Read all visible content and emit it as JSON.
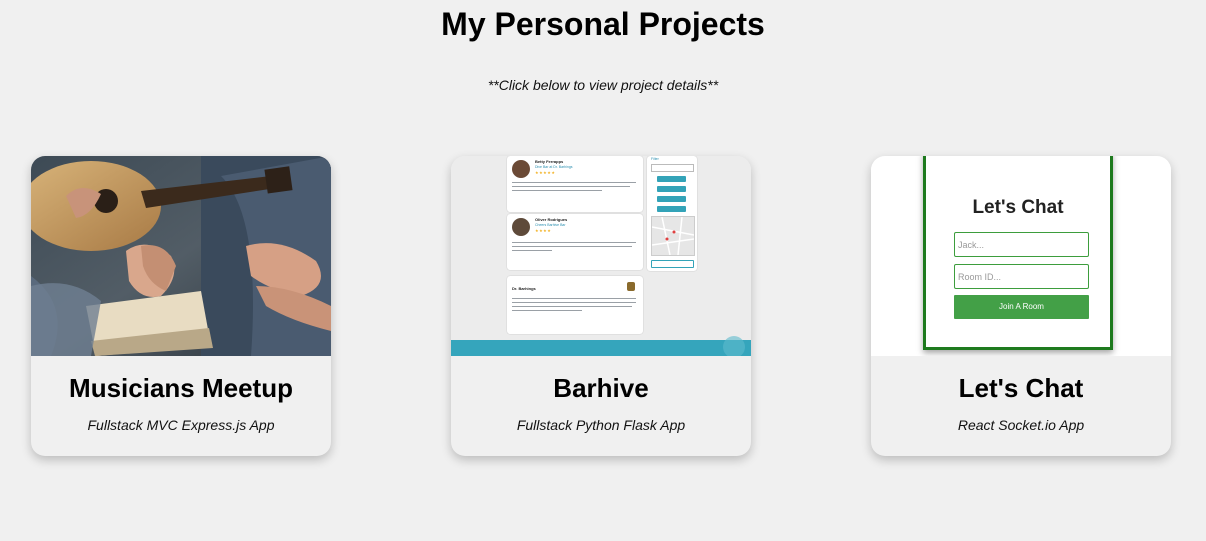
{
  "header": {
    "title": "My Personal Projects",
    "subtitle": "**Click below to view project details**"
  },
  "projects": [
    {
      "title": "Musicians Meetup",
      "description": "Fullstack MVC Express.js App",
      "thumbnail": "guitar-prayer-photo"
    },
    {
      "title": "Barhive",
      "description": "Fullstack Python Flask App",
      "thumbnail": "barhive-app-screenshot",
      "preview": {
        "posts": [
          {
            "name": "Betty Ferrapps",
            "at": "Dive Bar at Dr. Barhings"
          },
          {
            "name": "Oliver Rodrigues",
            "at": "Cheers Barhive Bar"
          },
          {
            "name": "Dr. Barhings",
            "at": ""
          }
        ],
        "sidebar_label": "Filter",
        "accent_color": "#35a5bc"
      }
    },
    {
      "title": "Let's Chat",
      "description": "React Socket.io App",
      "thumbnail": "lets-chat-app-screenshot",
      "preview": {
        "heading": "Let's Chat",
        "name_placeholder": "Jack...",
        "room_placeholder": "Room ID...",
        "button_label": "Join A Room",
        "accent_color": "#43a047"
      }
    }
  ]
}
